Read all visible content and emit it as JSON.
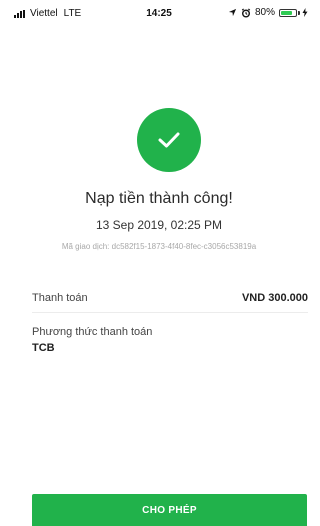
{
  "status_bar": {
    "carrier": "Viettel",
    "network": "LTE",
    "time": "14:25",
    "battery": "80%",
    "battery_level": 0.8,
    "icons": [
      "signal-icon",
      "location-arrow-icon",
      "alarm-icon",
      "battery-icon",
      "charging-bolt-icon"
    ]
  },
  "result": {
    "icon": "checkmark-icon",
    "title": "Nạp tiền thành công!",
    "datetime": "13 Sep 2019, 02:25 PM",
    "transaction": "Mã giao dịch: dc582f15-1873-4f40-8fec-c3056c53819a"
  },
  "details": {
    "amount_label": "Thanh toán",
    "amount_value": "VND 300.000",
    "method_label": "Phương thức thanh toán",
    "method_value": "TCB"
  },
  "actions": {
    "allow_label": "CHO PHÉP"
  },
  "colors": {
    "accent": "#21b24b",
    "text": "#222222",
    "muted": "#a8a8a8"
  }
}
